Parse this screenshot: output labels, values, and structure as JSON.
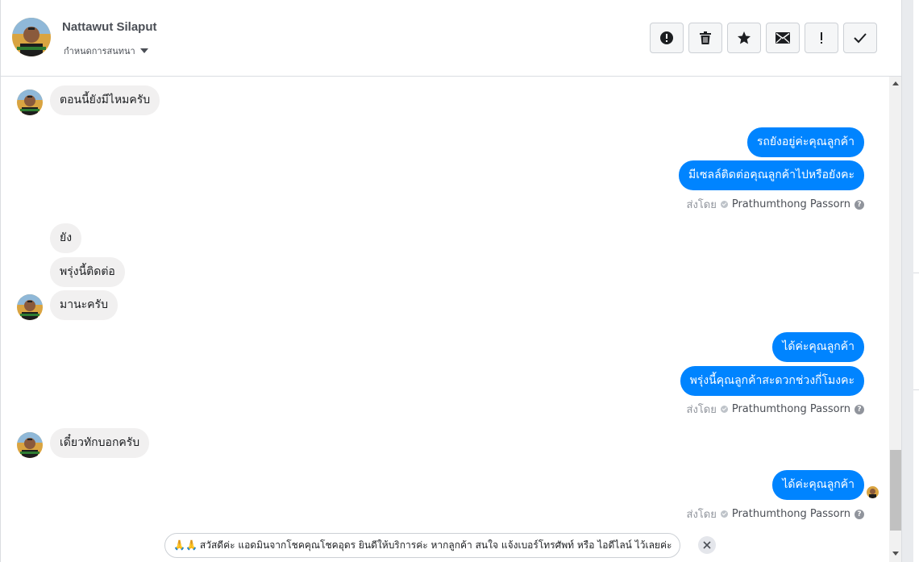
{
  "header": {
    "user_name": "Nattawut Silaput",
    "assign_label": "กำหนดการสนทนา",
    "toolbar": [
      {
        "name": "report-button",
        "icon": "alert-circle-icon"
      },
      {
        "name": "delete-button",
        "icon": "trash-icon"
      },
      {
        "name": "star-button",
        "icon": "star-icon"
      },
      {
        "name": "mark-unread-button",
        "icon": "envelope-icon"
      },
      {
        "name": "important-button",
        "icon": "exclamation-icon"
      },
      {
        "name": "done-button",
        "icon": "checkmark-icon"
      }
    ]
  },
  "messages": {
    "m1": "ตอนนี้ยังมีไหมครับ",
    "m2": "รถยังอยู่ค่ะคุณลูกค้า",
    "m3": "มีเซลล์ติดต่อคุณลูกค้าไปหรือยังคะ",
    "m4": "ยัง",
    "m5": "พรุ่งนี้ติดต่อ",
    "m6": "มานะครับ",
    "m7": "ได้ค่ะคุณลูกค้า",
    "m8": "พรุ่งนี้คุณลูกค้าสะดวกช่วงกี่โมงคะ",
    "m9": "เดี๋ยวทักบอกครับ",
    "m10": "ได้ค่ะคุณลูกค้า"
  },
  "sent_by": {
    "prefix": "ส่งโดย",
    "agent": "Prathumthong Passorn",
    "help": "?"
  },
  "suggestion": {
    "emoji": "🙏🙏",
    "text": "สวัสดีค่ะ แอดมินจากโชคคุณโชคอุดร ยินดีให้บริการค่ะ หากลูกค้า สนใจ แจ้งเบอร์โทรศัพท์ หรือ ไอดีไลน์ ไว้เลยค่ะ"
  },
  "colors": {
    "outgoing_bubble": "#0084ff",
    "incoming_bubble": "#f1f0f0"
  }
}
